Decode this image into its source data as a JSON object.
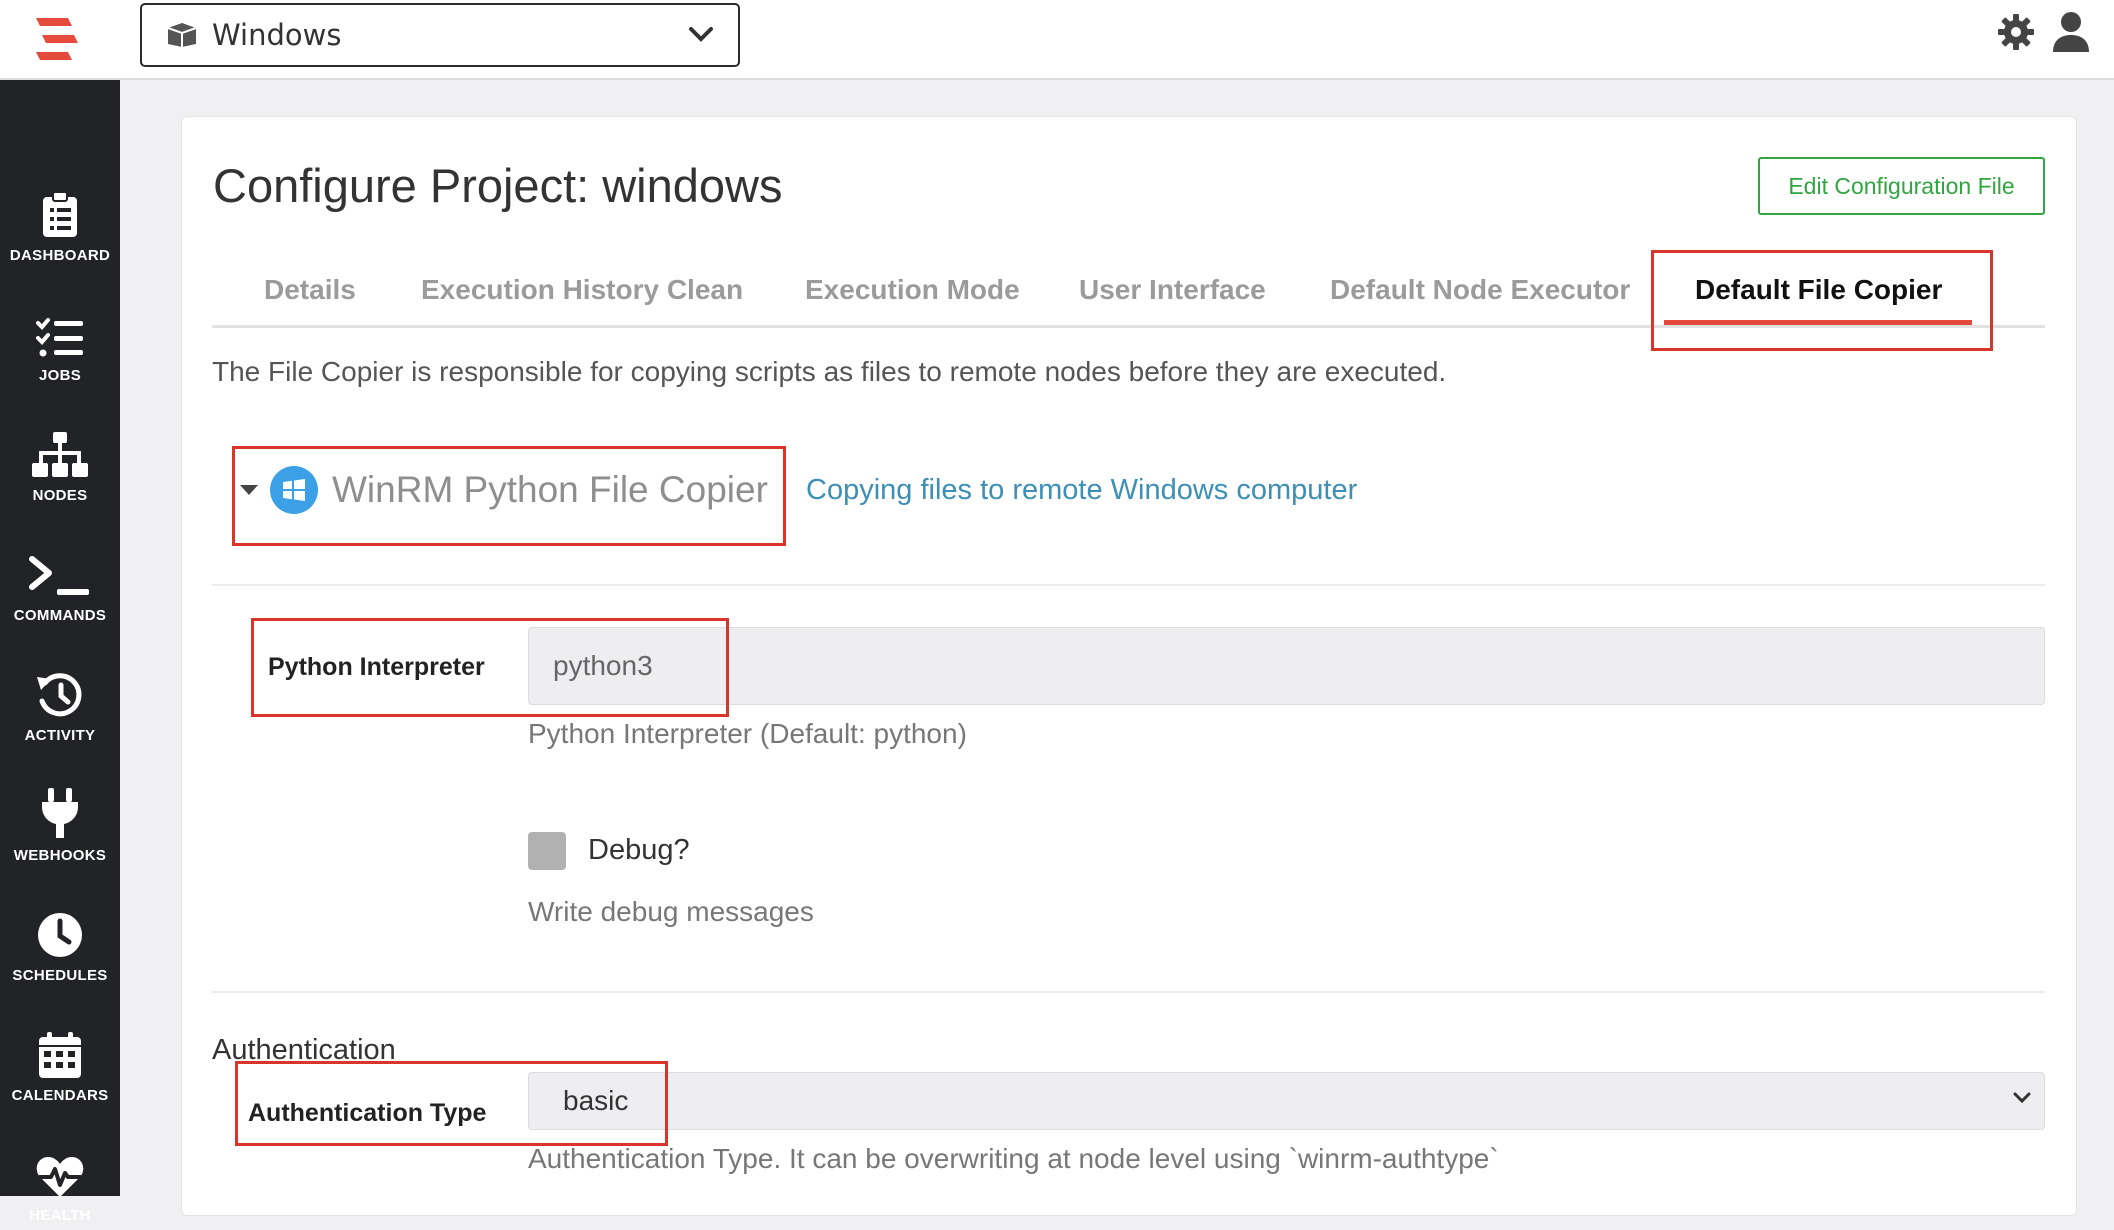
{
  "header": {
    "project_name": "Windows"
  },
  "sidebar": {
    "items": [
      {
        "label": "DASHBOARD"
      },
      {
        "label": "JOBS"
      },
      {
        "label": "NODES"
      },
      {
        "label": "COMMANDS"
      },
      {
        "label": "ACTIVITY"
      },
      {
        "label": "WEBHOOKS"
      },
      {
        "label": "SCHEDULES"
      },
      {
        "label": "CALENDARS"
      },
      {
        "label": "HEALTH"
      }
    ]
  },
  "page": {
    "title": "Configure Project: windows",
    "edit_config_label": "Edit Configuration File",
    "tabs": [
      {
        "label": "Details"
      },
      {
        "label": "Execution History Clean"
      },
      {
        "label": "Execution Mode"
      },
      {
        "label": "User Interface"
      },
      {
        "label": "Default Node Executor"
      },
      {
        "label": "Default File Copier"
      }
    ],
    "active_tab": "Default File Copier",
    "description": "The File Copier is responsible for copying scripts as files to remote nodes before they are executed."
  },
  "plugin": {
    "name": "WinRM Python File Copier",
    "link_text": "Copying files to remote Windows computer",
    "icon": "windows-icon"
  },
  "fields": {
    "python_interpreter": {
      "label": "Python Interpreter",
      "value": "python3",
      "help": "Python Interpreter (Default: python)"
    },
    "debug": {
      "label": "Debug?",
      "checked": false,
      "help": "Write debug messages"
    },
    "auth_section": "Authentication",
    "auth_type": {
      "label": "Authentication Type",
      "value": "basic",
      "help": "Authentication Type. It can be overwriting at node level using `winrm-authtype`"
    }
  },
  "colors": {
    "accent_red": "#e54b3c",
    "sidebar_bg": "#222326",
    "edit_button_green": "#31a640",
    "link_blue": "#3d8fb5",
    "windows_blue": "#3ba0e6"
  }
}
